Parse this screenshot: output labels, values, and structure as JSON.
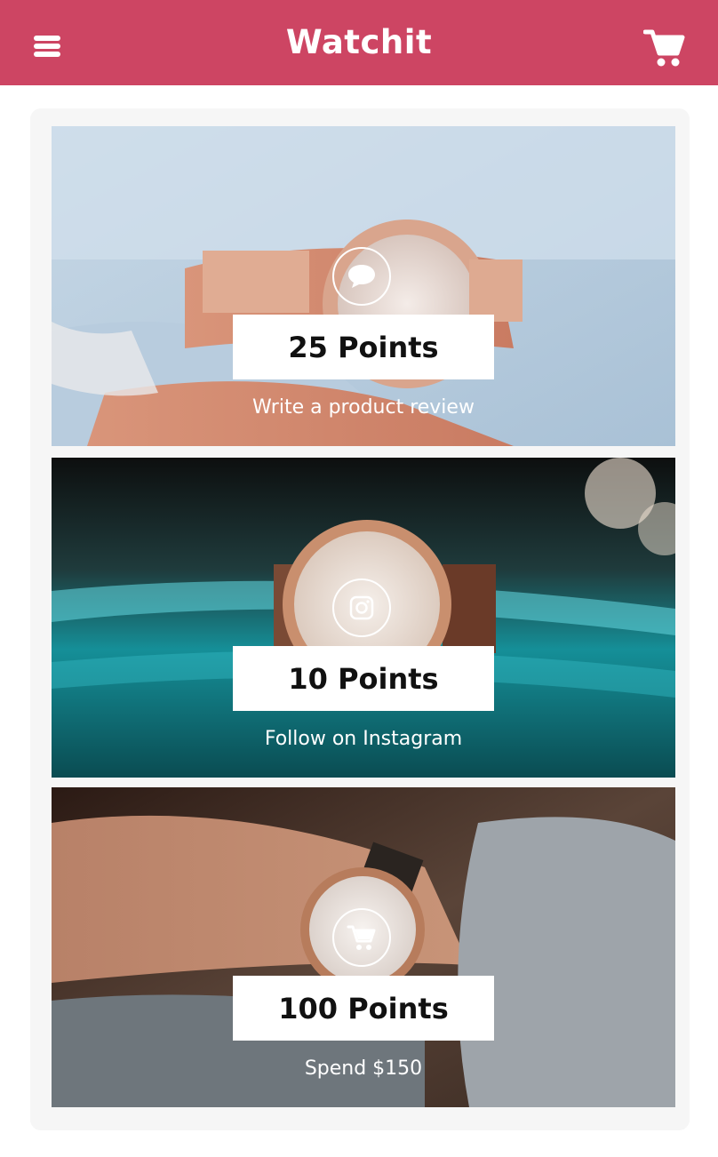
{
  "header": {
    "title": "Watchit",
    "menu_icon": "hamburger-menu-icon",
    "cart_icon": "shopping-cart-icon",
    "background_color": "#cd4563"
  },
  "rewards": [
    {
      "points_label": "25 Points",
      "action_label": "Write a product review",
      "icon": "speech-bubble-icon"
    },
    {
      "points_label": "10 Points",
      "action_label": "Follow on Instagram",
      "icon": "instagram-icon"
    },
    {
      "points_label": "100 Points",
      "action_label": "Spend $150",
      "icon": "shopping-cart-icon"
    }
  ]
}
